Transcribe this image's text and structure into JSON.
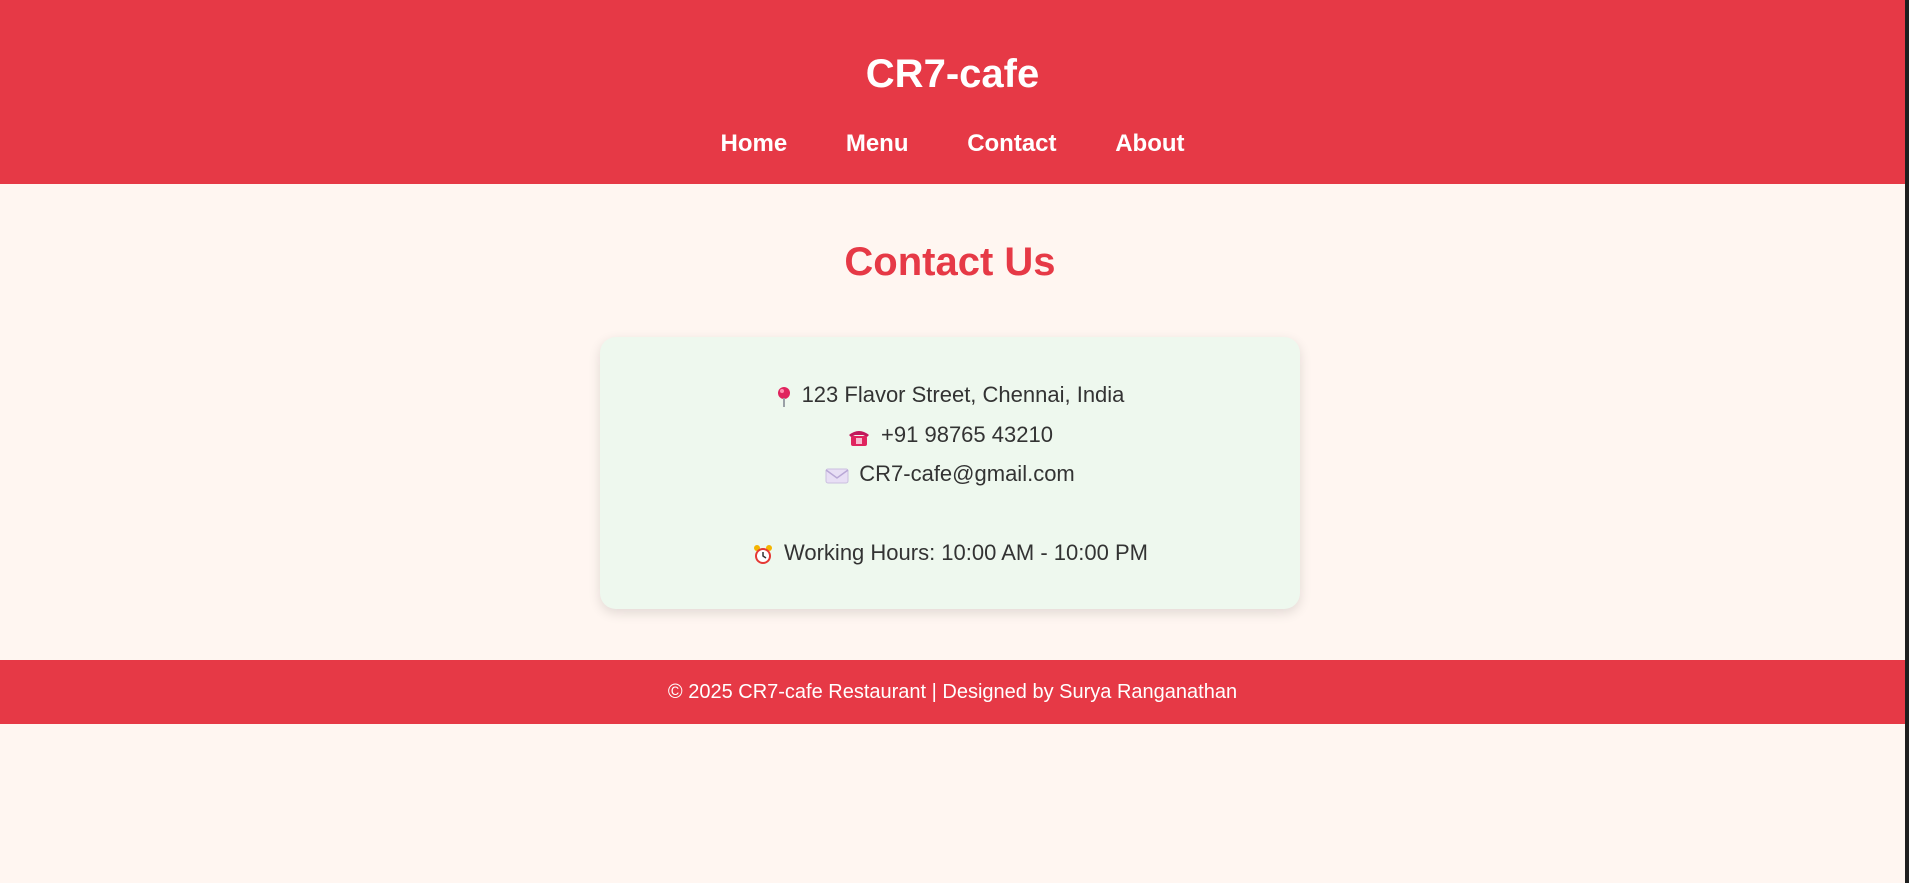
{
  "header": {
    "brand": "CR7-cafe",
    "nav": [
      {
        "label": "Home"
      },
      {
        "label": "Menu"
      },
      {
        "label": "Contact"
      },
      {
        "label": "About"
      }
    ]
  },
  "main": {
    "title": "Contact Us",
    "contact": {
      "address": "123 Flavor Street, Chennai, India",
      "address_icon": "pin-icon",
      "phone": "+91 98765 43210",
      "phone_icon": "phone-icon",
      "email": "CR7-cafe@gmail.com",
      "email_icon": "mail-icon",
      "hours": "Working Hours: 10:00 AM - 10:00 PM",
      "hours_icon": "clock-icon"
    }
  },
  "footer": {
    "text": "© 2025 CR7-cafe Restaurant | Designed by Surya Ranganathan"
  },
  "colors": {
    "accent": "#e63946",
    "background": "#fff6f1",
    "card": "#eef8ee"
  }
}
